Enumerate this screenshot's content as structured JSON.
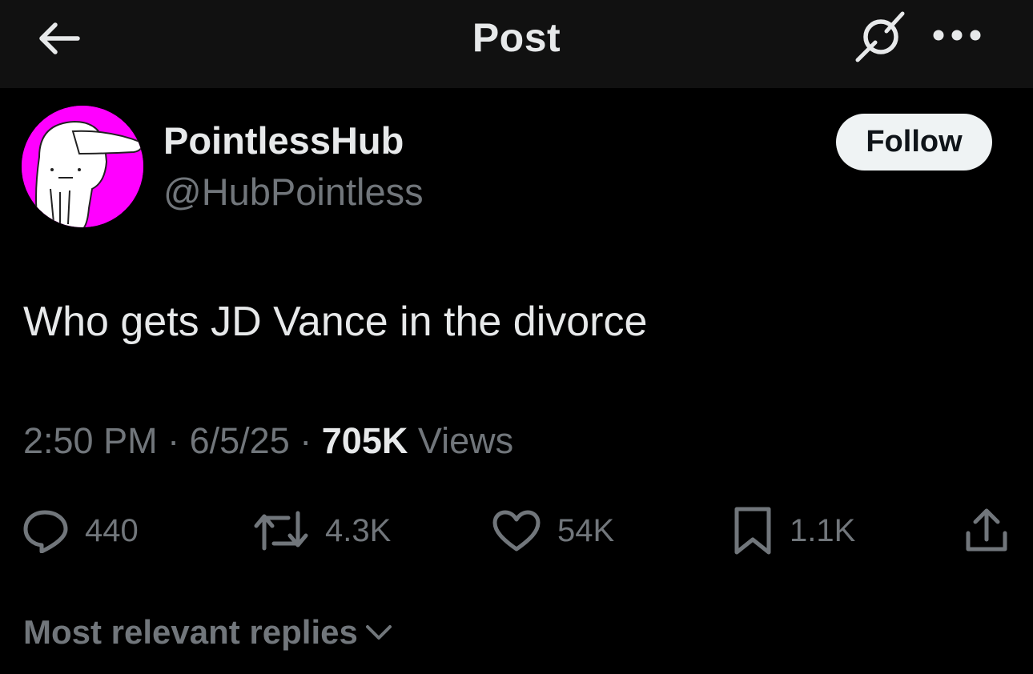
{
  "header": {
    "title": "Post",
    "back_icon": "arrow-left-icon",
    "grok_icon": "grok-icon",
    "more_icon": "more-horizontal-icon"
  },
  "author": {
    "display_name": "PointlessHub",
    "handle": "@HubPointless",
    "avatar_bg": "#ff00ff",
    "follow_label": "Follow"
  },
  "post": {
    "text": "Who gets JD Vance in the divorce",
    "time": "2:50 PM",
    "date": "6/5/25",
    "views_count": "705K",
    "views_label": "Views",
    "separator": "·"
  },
  "actions": {
    "replies": "440",
    "reposts": "4.3K",
    "likes": "54K",
    "bookmarks": "1.1K"
  },
  "replies_sort": {
    "label": "Most relevant replies"
  },
  "colors": {
    "background": "#000000",
    "header_bg": "#111111",
    "text_primary": "#e7e9ea",
    "text_secondary": "#71767b",
    "follow_bg": "#eff3f4"
  }
}
